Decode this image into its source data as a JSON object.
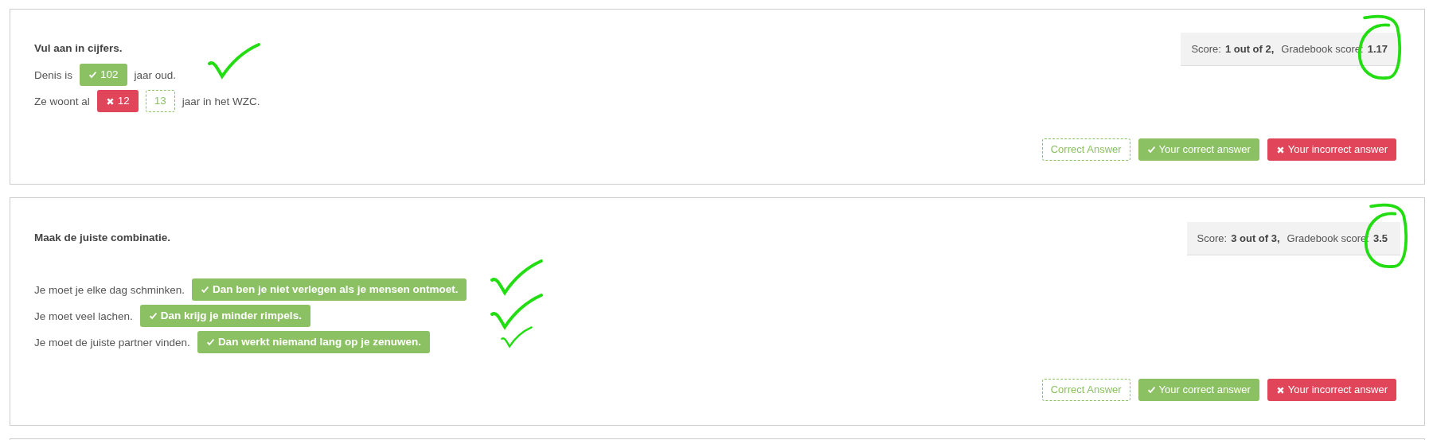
{
  "questions": [
    {
      "kind": "fill",
      "title": "Vul aan in cijfers.",
      "score": {
        "label": "Score:",
        "points": "1 out of 2,",
        "gradebook_label": "Gradebook score:",
        "gradebook": "1.17"
      },
      "lines": [
        {
          "parts": [
            {
              "kind": "text",
              "text": "Denis is"
            },
            {
              "kind": "correct",
              "text": "102"
            },
            {
              "kind": "text",
              "text": "jaar oud."
            }
          ]
        },
        {
          "parts": [
            {
              "kind": "text",
              "text": "Ze woont al"
            },
            {
              "kind": "incorrect",
              "text": "12"
            },
            {
              "kind": "key",
              "text": "13"
            },
            {
              "kind": "text",
              "text": "jaar in het WZC."
            }
          ]
        }
      ],
      "legend": [
        {
          "kind": "key",
          "text": "Correct Answer"
        },
        {
          "kind": "correct",
          "text": "Your correct answer"
        },
        {
          "kind": "incorrect",
          "text": "Your incorrect answer"
        }
      ],
      "annotations": [
        {
          "kind": "check"
        },
        {
          "kind": "circle"
        }
      ]
    },
    {
      "kind": "match",
      "title": "Maak de juiste combinatie.",
      "score": {
        "label": "Score:",
        "points": "3 out of 3,",
        "gradebook_label": "Gradebook score:",
        "gradebook": "3.5"
      },
      "lines": [
        {
          "parts": [
            {
              "kind": "text",
              "text": "Je moet je elke dag schminken."
            },
            {
              "kind": "correct",
              "text": "Dan ben je niet verlegen als je mensen ontmoet."
            }
          ]
        },
        {
          "parts": [
            {
              "kind": "text",
              "text": "Je moet veel lachen."
            },
            {
              "kind": "correct",
              "text": "Dan krijg je minder rimpels."
            }
          ]
        },
        {
          "parts": [
            {
              "kind": "text",
              "text": "Je moet de juiste partner vinden."
            },
            {
              "kind": "correct",
              "text": "Dan werkt niemand lang op je zenuwen."
            }
          ]
        }
      ],
      "legend": [
        {
          "kind": "key",
          "text": "Correct Answer"
        },
        {
          "kind": "correct",
          "text": "Your correct answer"
        },
        {
          "kind": "incorrect",
          "text": "Your incorrect answer"
        }
      ],
      "annotations": [
        {
          "kind": "check"
        },
        {
          "kind": "check"
        },
        {
          "kind": "check"
        },
        {
          "kind": "circle"
        }
      ]
    }
  ]
}
